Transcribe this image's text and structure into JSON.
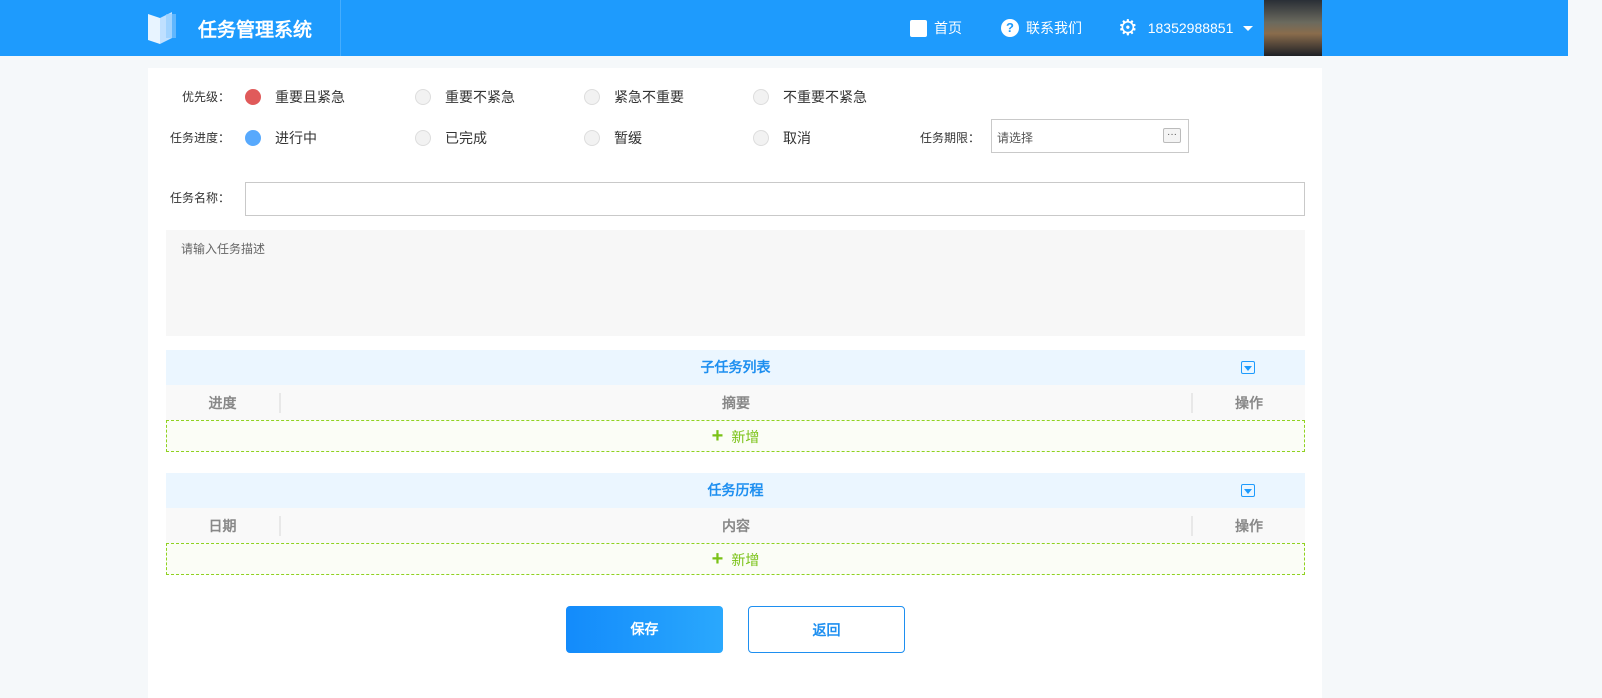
{
  "header": {
    "title": "任务管理系统",
    "nav": [
      {
        "label": "首页",
        "icon": "checklist-icon"
      },
      {
        "label": "联系我们",
        "icon": "question-icon"
      }
    ],
    "user": "18352988851"
  },
  "form": {
    "priority": {
      "label": "优先级：",
      "options": [
        "重要且紧急",
        "重要不紧急",
        "紧急不重要",
        "不重要不紧急"
      ],
      "selected": 0,
      "color": "#e05a5a"
    },
    "progress": {
      "label": "任务进度：",
      "options": [
        "进行中",
        "已完成",
        "暂缓",
        "取消"
      ],
      "selected": 0,
      "color": "#57a9fd"
    },
    "deadline": {
      "label": "任务期限：",
      "placeholder": "请选择",
      "button": "···"
    },
    "name": {
      "label": "任务名称：",
      "value": ""
    },
    "description": {
      "placeholder": "请输入任务描述"
    }
  },
  "subtasks": {
    "title": "子任务列表",
    "columns": [
      "进度",
      "摘要",
      "操作"
    ],
    "add": "新增"
  },
  "history": {
    "title": "任务历程",
    "columns": [
      "日期",
      "内容",
      "操作"
    ],
    "add": "新增"
  },
  "actions": {
    "save": "保存",
    "back": "返回"
  }
}
